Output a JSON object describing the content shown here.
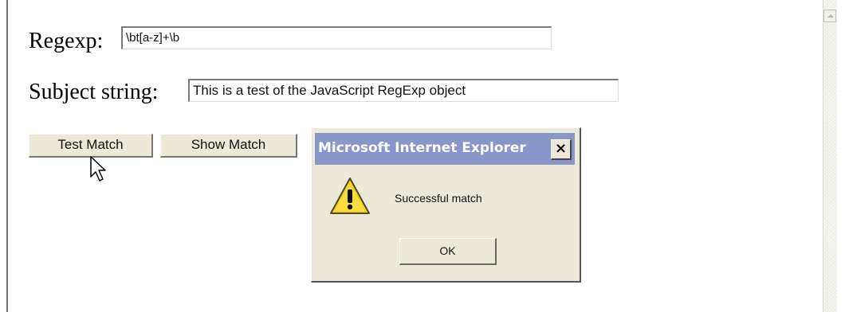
{
  "form": {
    "regexp_label": "Regexp:",
    "regexp_value": "\\bt[a-z]+\\b",
    "subject_label": "Subject string:",
    "subject_value": "This is a test of the JavaScript RegExp object"
  },
  "buttons": {
    "test_match": "Test Match",
    "show_match": "Show Match"
  },
  "dialog": {
    "title": "Microsoft Internet Explorer",
    "close_glyph": "×",
    "message": "Successful match",
    "ok_label": "OK",
    "icon": "warning-icon"
  },
  "colors": {
    "dialog_titlebar": "#8896ca",
    "dialog_face": "#ece9d8",
    "warning_yellow": "#f6d11c"
  }
}
